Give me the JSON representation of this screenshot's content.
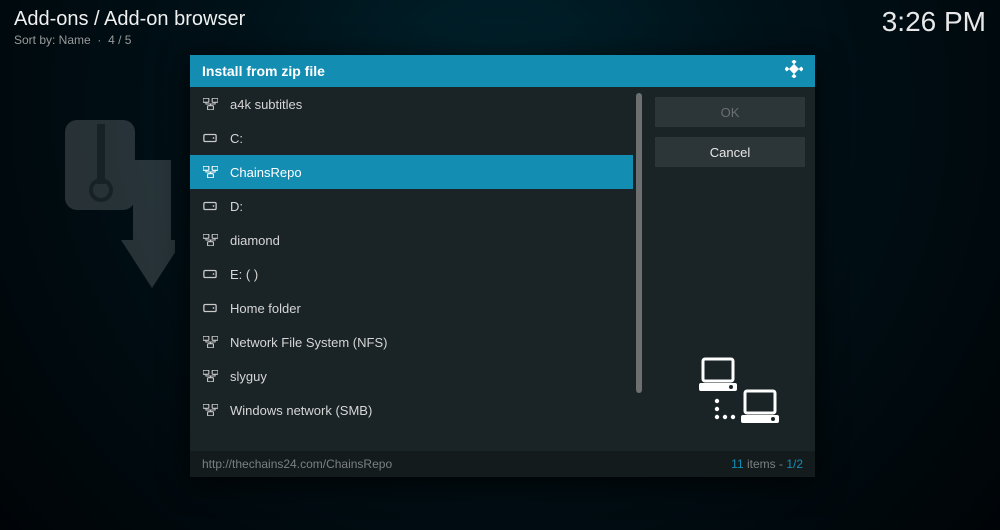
{
  "header": {
    "breadcrumb": "Add-ons / Add-on browser",
    "sort_label": "Sort by: Name",
    "page_indicator": "4 / 5",
    "clock": "3:26 PM"
  },
  "dialog": {
    "title": "Install from zip file",
    "ok_label": "OK",
    "cancel_label": "Cancel",
    "items": [
      {
        "label": "a4k subtitles",
        "icon": "network",
        "selected": false
      },
      {
        "label": "C:",
        "icon": "drive",
        "selected": false
      },
      {
        "label": "ChainsRepo",
        "icon": "network",
        "selected": true
      },
      {
        "label": "D:",
        "icon": "drive",
        "selected": false
      },
      {
        "label": "diamond",
        "icon": "network",
        "selected": false
      },
      {
        "label": "E: ( )",
        "icon": "drive",
        "selected": false
      },
      {
        "label": "Home folder",
        "icon": "drive",
        "selected": false
      },
      {
        "label": "Network File System (NFS)",
        "icon": "network",
        "selected": false
      },
      {
        "label": "slyguy",
        "icon": "network",
        "selected": false
      },
      {
        "label": "Windows network (SMB)",
        "icon": "network",
        "selected": false
      }
    ],
    "footer": {
      "path": "http://thechains24.com/ChainsRepo",
      "item_count": "11",
      "items_suffix": " items - ",
      "page": "1/2"
    }
  }
}
